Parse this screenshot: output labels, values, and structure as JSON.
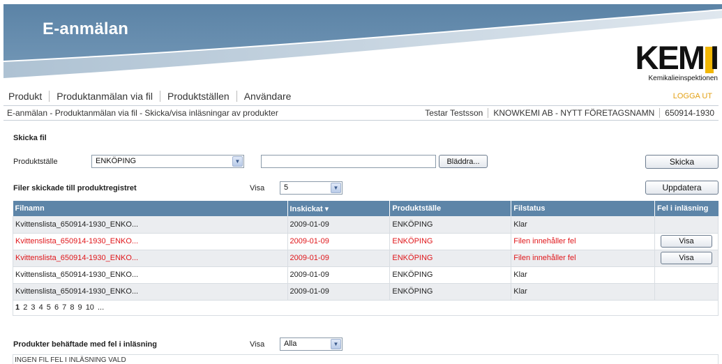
{
  "app": {
    "title": "E-anmälan"
  },
  "logo": {
    "word_main": "KEM",
    "word_last": "I",
    "subtitle": "Kemikalieinspektionen"
  },
  "nav": {
    "items": [
      "Produkt",
      "Produktanmälan via fil",
      "Produktställen",
      "Användare"
    ],
    "logout": "LOGGA UT"
  },
  "breadcrumb": "E-anmälan - Produktanmälan via fil - Skicka/visa inläsningar av produkter",
  "user": {
    "name": "Testar Testsson",
    "company": "KNOWKEMI AB - NYTT FÖRETAGSNAMN",
    "id": "650914-1930"
  },
  "send": {
    "title": "Skicka fil",
    "site_label": "Produktställe",
    "site_value": "ENKÖPING",
    "file_value": "",
    "browse_label": "Bläddra...",
    "submit_label": "Skicka"
  },
  "files": {
    "title": "Filer skickade till produktregistret",
    "show_label": "Visa",
    "show_value": "5",
    "refresh_label": "Uppdatera",
    "columns": [
      "Filnamn",
      "Inskickat ▾",
      "Produktställe",
      "Filstatus",
      "Fel i inläsning"
    ],
    "rows": [
      {
        "name": "Kvittenslista_650914-1930_ENKO...",
        "date": "2009-01-09",
        "site": "ENKÖPING",
        "status": "Klar",
        "action": ""
      },
      {
        "name": "Kvittenslista_650914-1930_ENKO...",
        "date": "2009-01-09",
        "site": "ENKÖPING",
        "status": "Filen innehåller fel",
        "action": "Visa"
      },
      {
        "name": "Kvittenslista_650914-1930_ENKO...",
        "date": "2009-01-09",
        "site": "ENKÖPING",
        "status": "Filen innehåller fel",
        "action": "Visa"
      },
      {
        "name": "Kvittenslista_650914-1930_ENKO...",
        "date": "2009-01-09",
        "site": "ENKÖPING",
        "status": "Klar",
        "action": ""
      },
      {
        "name": "Kvittenslista_650914-1930_ENKO...",
        "date": "2009-01-09",
        "site": "ENKÖPING",
        "status": "Klar",
        "action": ""
      }
    ],
    "pages": [
      "1",
      "2",
      "3",
      "4",
      "5",
      "6",
      "7",
      "8",
      "9",
      "10",
      "..."
    ],
    "current_page": "1"
  },
  "errors": {
    "title": "Produkter behäftade med fel i inläsning",
    "show_label": "Visa",
    "show_value": "Alla",
    "empty_text": "INGEN FIL FEL I INLÄSNING VALD"
  },
  "colors": {
    "header_blue": "#5d85a8",
    "error_red": "#e0161a",
    "logout_orange": "#e3a013",
    "logo_yellow": "#f2b705"
  }
}
